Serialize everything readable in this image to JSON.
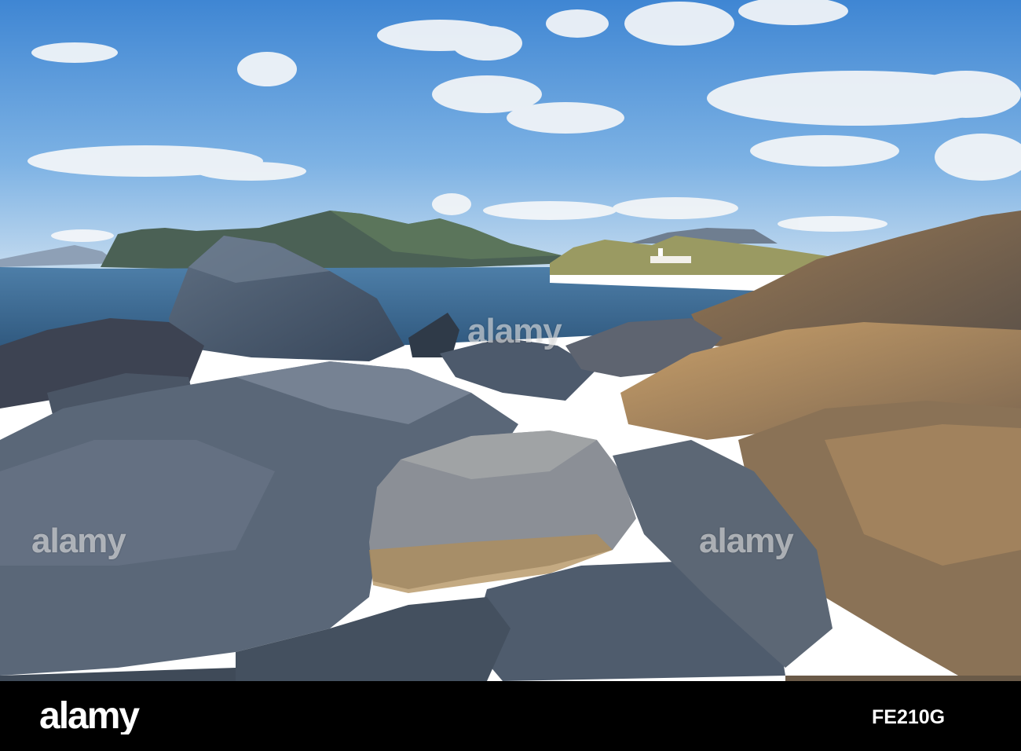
{
  "watermark": {
    "brand": "alamy",
    "text": "alamy"
  },
  "footer": {
    "logo_text": "alamy",
    "image_id": "FE210G"
  },
  "colors": {
    "sky_top": "#4d8fd6",
    "sky_bottom": "#a6c9ea",
    "sea": "#3f6f97",
    "rock_shadow": "#3c4a5c",
    "rock_sunlit": "#b48a55",
    "footer_bg": "#000000"
  }
}
